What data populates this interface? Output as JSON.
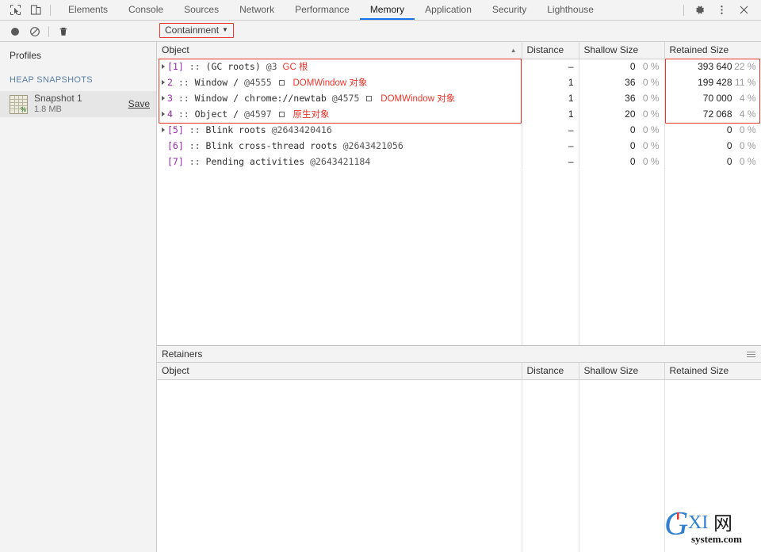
{
  "tabbar": {
    "icons": [
      {
        "name": "inspect-element-icon"
      },
      {
        "name": "device-toolbar-icon"
      }
    ],
    "tabs": [
      {
        "label": "Elements",
        "active": false
      },
      {
        "label": "Console",
        "active": false
      },
      {
        "label": "Sources",
        "active": false
      },
      {
        "label": "Network",
        "active": false
      },
      {
        "label": "Performance",
        "active": false
      },
      {
        "label": "Memory",
        "active": true
      },
      {
        "label": "Application",
        "active": false
      },
      {
        "label": "Security",
        "active": false
      },
      {
        "label": "Lighthouse",
        "active": false
      }
    ],
    "right_icons": [
      {
        "name": "settings-gear-icon"
      },
      {
        "name": "more-options-icon"
      },
      {
        "name": "close-devtools-icon"
      }
    ],
    "active_tab_underline_color": "#1a73e8"
  },
  "toolbar": {
    "record_label": "Record",
    "clear_label": "Clear",
    "delete_label": "Delete",
    "view_select": "Containment",
    "view_caret": "▼",
    "highlight_color": "#e8352b"
  },
  "sidebar": {
    "title": "Profiles",
    "section_label": "HEAP SNAPSHOTS",
    "snapshot": {
      "name": "Snapshot 1",
      "size": "1.8 MB",
      "save_label": "Save",
      "percent_glyph": "%"
    }
  },
  "grid": {
    "columns": [
      {
        "key": "object",
        "label": "Object",
        "sorted": true,
        "sort_arrow": "▲"
      },
      {
        "key": "distance",
        "label": "Distance"
      },
      {
        "key": "shallow",
        "label": "Shallow Size"
      },
      {
        "key": "retained",
        "label": "Retained Size"
      }
    ],
    "rows": [
      {
        "expandable": true,
        "index": "[1]",
        "sep": "::",
        "name": "(GC roots)",
        "at": "@3",
        "has_box_icon": false,
        "annotation": "GC 根",
        "distance": "–",
        "shallow": "0",
        "shallow_pct": "0 %",
        "retained": "393 640",
        "retained_pct": "22 %"
      },
      {
        "expandable": true,
        "index": "2",
        "sep": "::",
        "name": "Window /",
        "at": "@4555",
        "has_box_icon": true,
        "annotation": "DOMWindow 对象",
        "distance": "1",
        "shallow": "36",
        "shallow_pct": "0 %",
        "retained": "199 428",
        "retained_pct": "11 %"
      },
      {
        "expandable": true,
        "index": "3",
        "sep": "::",
        "name": "Window / chrome://newtab",
        "at": "@4575",
        "has_box_icon": true,
        "annotation": "DOMWindow 对象",
        "distance": "1",
        "shallow": "36",
        "shallow_pct": "0 %",
        "retained": "70 000",
        "retained_pct": "4 %"
      },
      {
        "expandable": true,
        "index": "4",
        "sep": "::",
        "name": "Object /",
        "at": "@4597",
        "has_box_icon": true,
        "annotation": "原生对象",
        "distance": "1",
        "shallow": "20",
        "shallow_pct": "0 %",
        "retained": "72 068",
        "retained_pct": "4 %"
      },
      {
        "expandable": true,
        "index": "[5]",
        "sep": "::",
        "name": "Blink roots",
        "at": "@2643420416",
        "has_box_icon": false,
        "annotation": "",
        "distance": "–",
        "shallow": "0",
        "shallow_pct": "0 %",
        "retained": "0",
        "retained_pct": "0 %"
      },
      {
        "expandable": false,
        "index": "[6]",
        "sep": "::",
        "name": "Blink cross-thread roots",
        "at": "@2643421056",
        "has_box_icon": false,
        "annotation": "",
        "distance": "–",
        "shallow": "0",
        "shallow_pct": "0 %",
        "retained": "0",
        "retained_pct": "0 %"
      },
      {
        "expandable": false,
        "index": "[7]",
        "sep": "::",
        "name": "Pending activities",
        "at": "@2643421184",
        "has_box_icon": false,
        "annotation": "",
        "distance": "–",
        "shallow": "0",
        "shallow_pct": "0 %",
        "retained": "0",
        "retained_pct": "0 %"
      }
    ]
  },
  "retainers": {
    "title": "Retainers",
    "menu_label": "More",
    "columns": [
      {
        "key": "object",
        "label": "Object"
      },
      {
        "key": "distance",
        "label": "Distance"
      },
      {
        "key": "shallow",
        "label": "Shallow Size"
      },
      {
        "key": "retained",
        "label": "Retained Size"
      }
    ],
    "rows": []
  },
  "watermark": {
    "main": "GXI网",
    "sub": "system.com",
    "color": "#2f7fd0"
  }
}
